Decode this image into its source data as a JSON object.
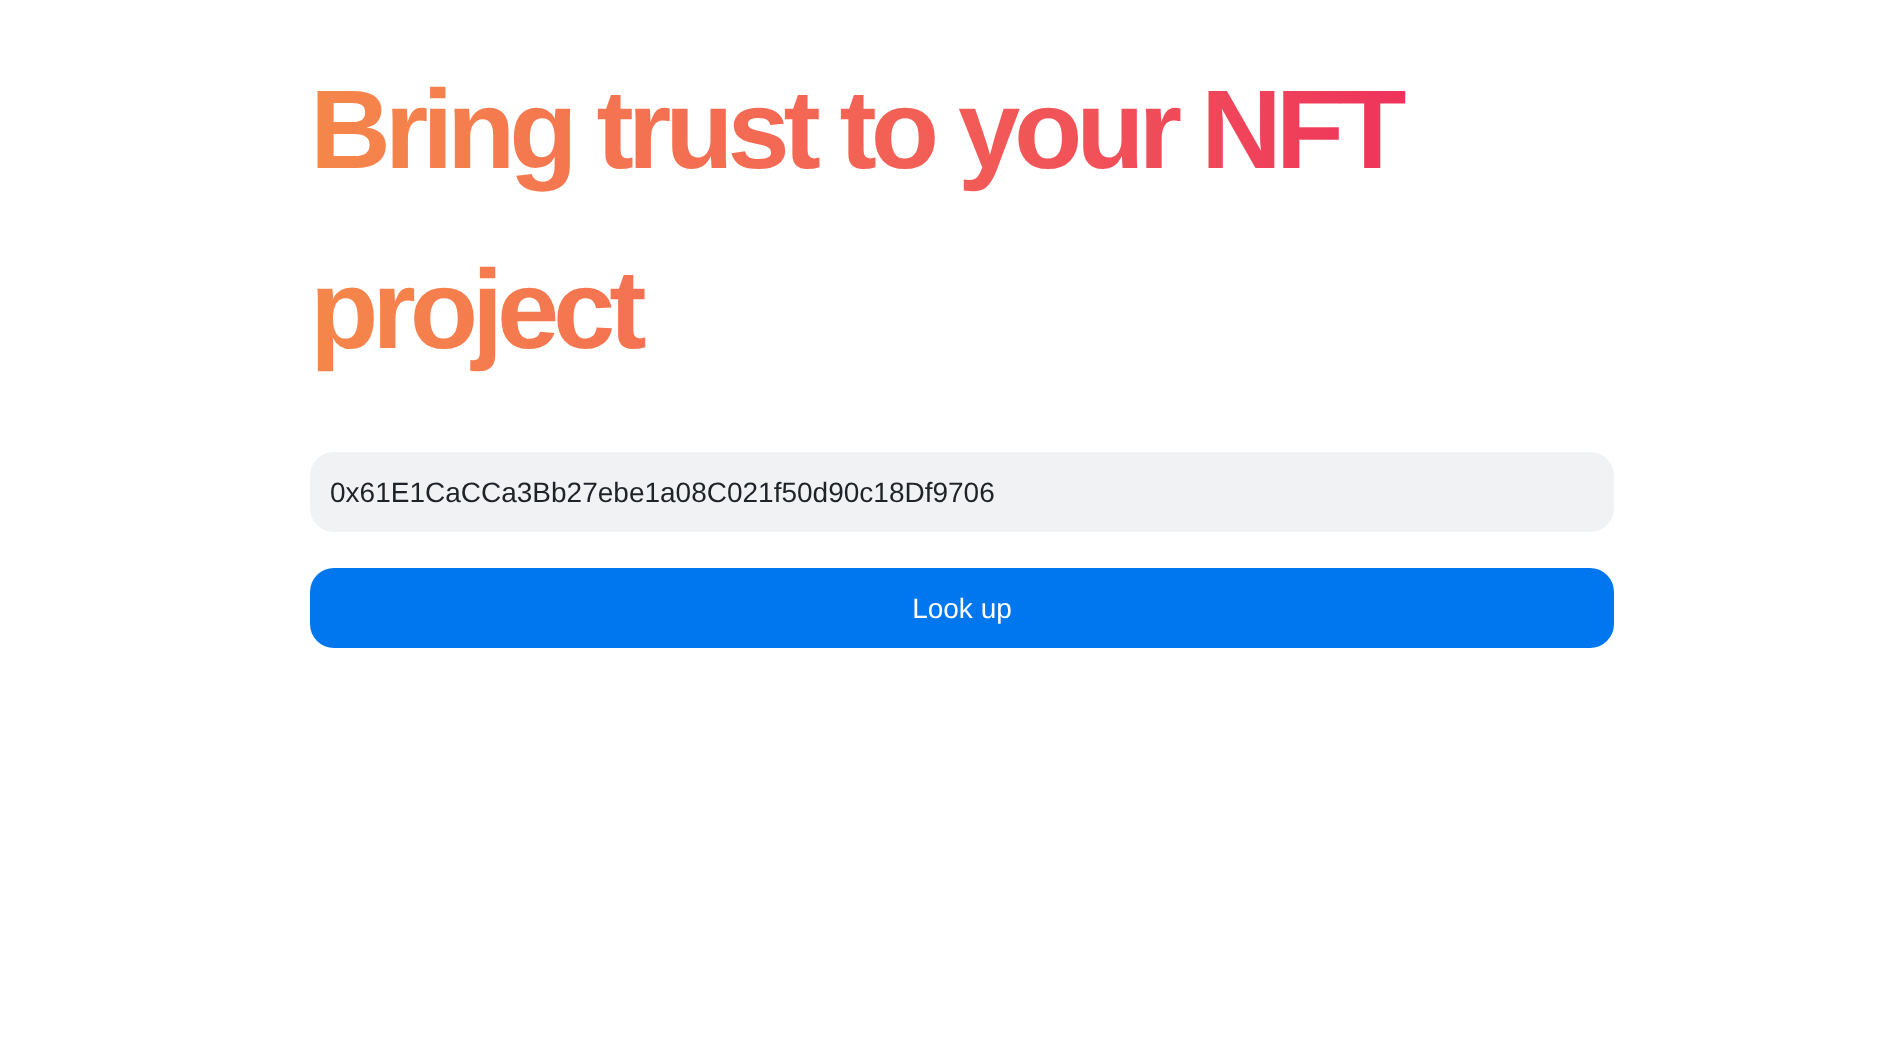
{
  "heading": "Bring trust to your NFT project",
  "address_field": {
    "value": "0x61E1CaCCa3Bb27ebe1a08C021f50d90c18Df9706"
  },
  "lookup_button": {
    "label": "Look up"
  }
}
